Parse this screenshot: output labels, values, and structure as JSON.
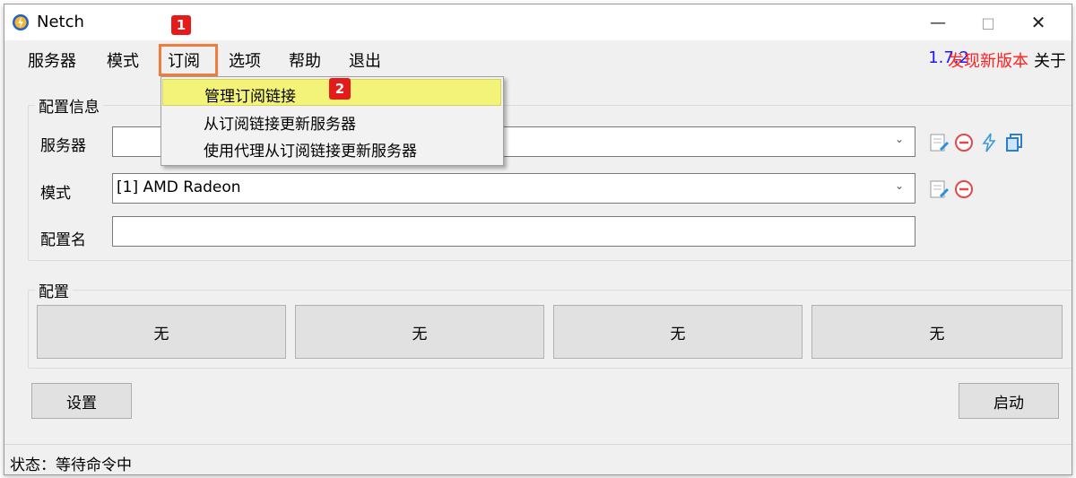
{
  "window": {
    "title": "Netch"
  },
  "menu": {
    "items": [
      {
        "label": "服务器"
      },
      {
        "label": "模式"
      },
      {
        "label": "订阅"
      },
      {
        "label": "选项"
      },
      {
        "label": "帮助"
      },
      {
        "label": "退出"
      }
    ],
    "version": "1.7.2",
    "update": "发现新版本",
    "about": "关于"
  },
  "annotations": {
    "badge1": "1",
    "badge2": "2"
  },
  "dropdown": {
    "items": [
      {
        "label": "管理订阅链接"
      },
      {
        "label": "从订阅链接更新服务器"
      },
      {
        "label": "使用代理从订阅链接更新服务器"
      }
    ]
  },
  "config_info": {
    "title": "配置信息",
    "server_label": "服务器",
    "server_value": "",
    "mode_label": "模式",
    "mode_value": "[1] AMD Radeon",
    "profile_label": "配置名",
    "profile_value": ""
  },
  "profiles": {
    "title": "配置",
    "buttons": [
      "无",
      "无",
      "无",
      "无"
    ]
  },
  "actions": {
    "settings": "设置",
    "start": "启动"
  },
  "status": {
    "text": "状态：等待命令中"
  },
  "colors": {
    "accent_orange": "#f07c3c",
    "badge_red": "#e51b1b",
    "version_blue": "#1a1aff",
    "update_red": "#ff2020",
    "highlight_yellow": "#f3f37a"
  },
  "icons": [
    "app-icon",
    "edit-icon",
    "remove-icon",
    "speed-test-icon",
    "copy-icon"
  ]
}
